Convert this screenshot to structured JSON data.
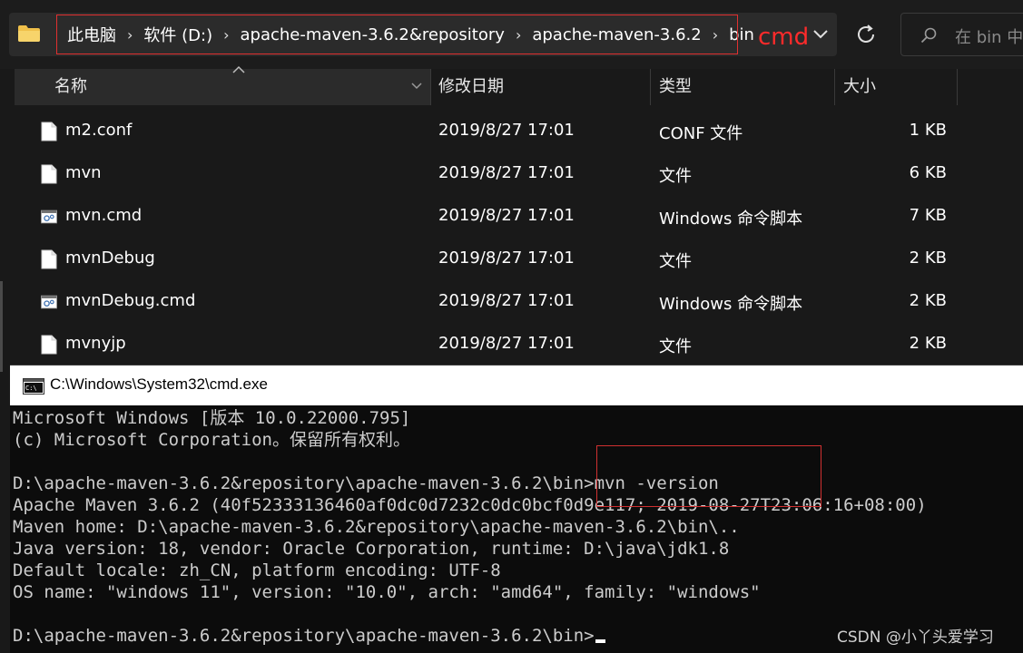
{
  "breadcrumb": [
    "此电脑",
    "软件 (D:)",
    "apache-maven-3.6.2&repository",
    "apache-maven-3.6.2",
    "bin"
  ],
  "breadcrumb_separator": "›",
  "annotation_label": "cmd",
  "search": {
    "placeholder": "在 bin 中"
  },
  "columns": {
    "name": "名称",
    "modified": "修改日期",
    "type": "类型",
    "size": "大小"
  },
  "files": [
    {
      "name": "m2.conf",
      "modified": "2019/8/27 17:01",
      "type": "CONF 文件",
      "size": "1 KB",
      "icon": "file-icon"
    },
    {
      "name": "mvn",
      "modified": "2019/8/27 17:01",
      "type": "文件",
      "size": "6 KB",
      "icon": "file-icon"
    },
    {
      "name": "mvn.cmd",
      "modified": "2019/8/27 17:01",
      "type": "Windows 命令脚本",
      "size": "7 KB",
      "icon": "cmd-script-icon"
    },
    {
      "name": "mvnDebug",
      "modified": "2019/8/27 17:01",
      "type": "文件",
      "size": "2 KB",
      "icon": "file-icon"
    },
    {
      "name": "mvnDebug.cmd",
      "modified": "2019/8/27 17:01",
      "type": "Windows 命令脚本",
      "size": "2 KB",
      "icon": "cmd-script-icon"
    },
    {
      "name": "mvnyjp",
      "modified": "2019/8/27 17:01",
      "type": "文件",
      "size": "2 KB",
      "icon": "file-icon"
    }
  ],
  "cmd_window": {
    "title": "C:\\Windows\\System32\\cmd.exe",
    "lines": [
      "Microsoft Windows [版本 10.0.22000.795]",
      "(c) Microsoft Corporation。保留所有权利。",
      "",
      "D:\\apache-maven-3.6.2&repository\\apache-maven-3.6.2\\bin>mvn -version",
      "Apache Maven 3.6.2 (40f52333136460af0dc0d7232c0dc0bcf0d9e117; 2019-08-27T23:06:16+08:00)",
      "Maven home: D:\\apache-maven-3.6.2&repository\\apache-maven-3.6.2\\bin\\..",
      "Java version: 18, vendor: Oracle Corporation, runtime: D:\\java\\jdk1.8",
      "Default locale: zh_CN, platform encoding: UTF-8",
      "OS name: \"windows 11\", version: \"10.0\", arch: \"amd64\", family: \"windows\"",
      "",
      "D:\\apache-maven-3.6.2&repository\\apache-maven-3.6.2\\bin>"
    ]
  },
  "watermark": "CSDN @小丫头爱学习",
  "colors": {
    "explorer_bg": "#191919",
    "console_bg": "#0c0c0c",
    "console_text": "#cccccc",
    "annotation_red": "#ff2b2b"
  }
}
